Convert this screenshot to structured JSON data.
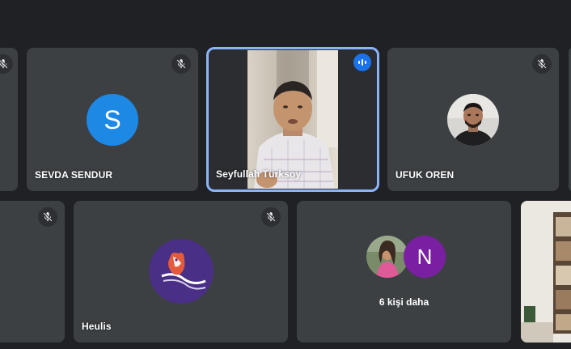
{
  "participants": {
    "sevda": {
      "name": "SEVDA SENDUR",
      "initial": "S",
      "avatar_color": "#1e88e5",
      "muted": true
    },
    "seyfullah": {
      "name": "Seyfullah Türksoy",
      "speaking": true
    },
    "ufuk": {
      "name": "UFUK OREN",
      "muted": true
    },
    "heulis": {
      "name": "Heulis",
      "muted": true
    },
    "overflow": {
      "label": "6 kişi daha",
      "initial": "N",
      "avatar_color": "#7b1fa2"
    }
  },
  "colors": {
    "background": "#202124",
    "tile": "#3c4043",
    "active_speaker_border": "#8ab4f8",
    "speaking_badge": "#1a73e8"
  },
  "icons": {
    "mute": "mic-off-icon",
    "speaking": "audio-bars-icon"
  }
}
